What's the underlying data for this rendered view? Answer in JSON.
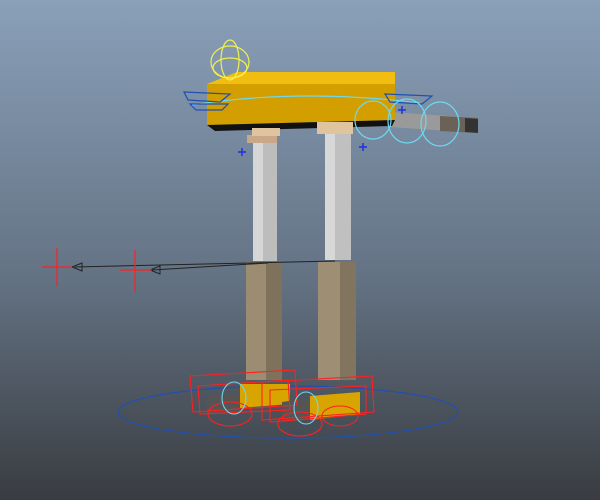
{
  "viewport": {
    "colors": {
      "bg_top": "#8a9fb8",
      "bg_bottom": "#3a3d42",
      "body": "#e0a800",
      "upper_leg": "#b4b4b4",
      "lower_leg": "#9a8b70",
      "joint": "#d4b48a",
      "control_ik": "#ff2020",
      "control_fk": "#6fd8ee",
      "control_root": "#2050b0",
      "control_head": "#f0f050",
      "locator": "#2030e0"
    }
  }
}
